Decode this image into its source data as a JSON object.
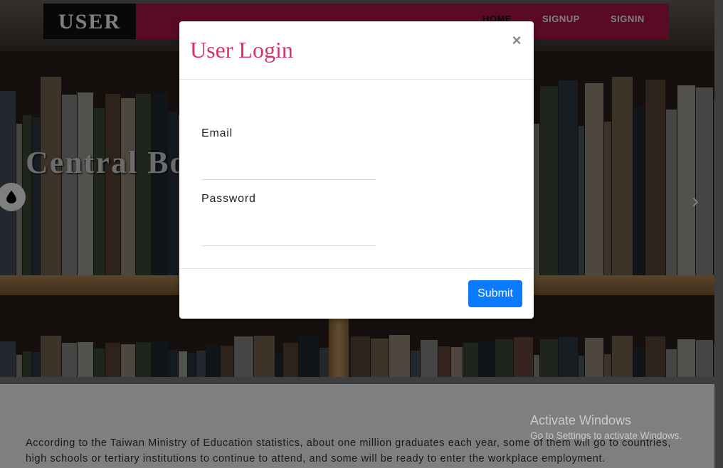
{
  "navbar": {
    "brand": "USER",
    "links": [
      "HOME",
      "SIGNUP",
      "SIGNIN"
    ]
  },
  "hero": {
    "title": "Central Bo"
  },
  "icons": {
    "theme_toggle": "water-drop-icon",
    "carousel_next": "chevron-right-icon",
    "close": "close-icon"
  },
  "content": {
    "paragraph": "According to the Taiwan Ministry of Education statistics, about one million graduates each year, some of them will go to countries, high schools or tertiary institutions to continue to attend, and some will be ready to enter the workplace employment."
  },
  "watermark": {
    "title": "Activate Windows",
    "subtitle": "Go to Settings to activate Windows."
  },
  "modal": {
    "title": "User Login",
    "close_label": "×",
    "email_label": "Email",
    "email_value": "",
    "password_label": "Password",
    "password_value": "",
    "submit_label": "Submit"
  },
  "colors": {
    "navbar": "#b5154b",
    "modal_title": "#d6336c",
    "submit": "#0a7bff"
  }
}
